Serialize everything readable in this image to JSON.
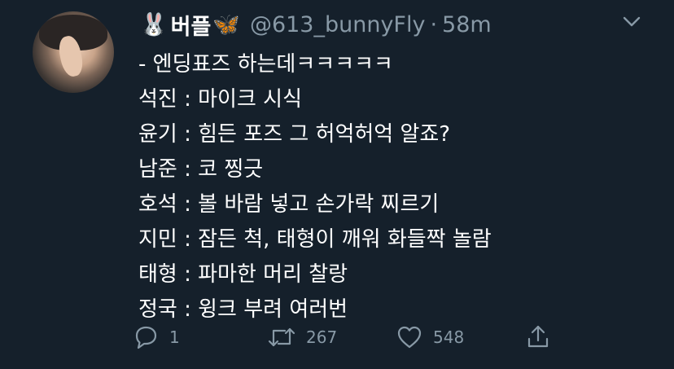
{
  "tweet": {
    "author": {
      "name": "버플",
      "prefix_emoji": "🐰",
      "suffix_emoji": "🦋",
      "handle": "@613_bunnyFly",
      "time": "58m"
    },
    "lines": [
      "- 엔딩표즈 하는데ㅋㅋㅋㅋㅋ",
      "석진 : 마이크 시식",
      "윤기 : 힘든 포즈 그 허억허억 알죠?",
      "남준 : 코 찡긋",
      "호석 : 볼 바람 넣고 손가락 찌르기",
      "지민 : 잠든 척, 태형이 깨워 화들짝 놀람",
      "태형 : 파마한 머리 찰랑",
      "정국 : 윙크 부려 여러번"
    ],
    "actions": {
      "reply_count": "1",
      "retweet_count": "267",
      "like_count": "548"
    }
  },
  "icons": {
    "reply": "reply-icon",
    "retweet": "retweet-icon",
    "like": "heart-icon",
    "share": "share-icon",
    "more": "chevron-down-icon"
  },
  "colors": {
    "background": "#15202b",
    "text": "#ffffff",
    "secondary": "#8899a6"
  }
}
